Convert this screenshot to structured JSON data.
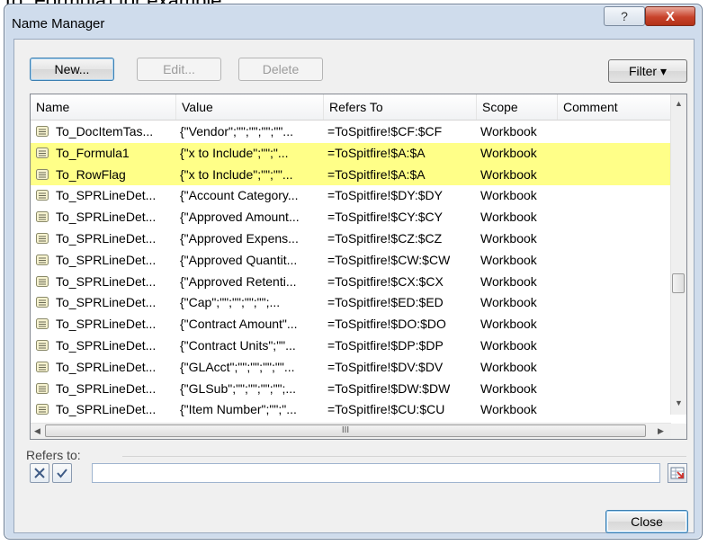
{
  "above_text": "To_Formula) for example.",
  "dialog": {
    "title": "Name Manager",
    "help_label": "?",
    "close_label": "X"
  },
  "toolbar": {
    "new_label": "New...",
    "edit_label": "Edit...",
    "delete_label": "Delete",
    "filter_label": "Filter ▾"
  },
  "columns": [
    "Name",
    "Value",
    "Refers To",
    "Scope",
    "Comment"
  ],
  "rows": [
    {
      "name": "To_DocItemTas...",
      "value": "{\"Vendor\";\"\";\"\";\"\";\"\"...",
      "refers_to": "=ToSpitfire!$CF:$CF",
      "scope": "Workbook",
      "comment": "",
      "highlighted": false
    },
    {
      "name": "To_Formula1",
      "value": "{\"x to Include\";\"\";\"...",
      "refers_to": "=ToSpitfire!$A:$A",
      "scope": "Workbook",
      "comment": "",
      "highlighted": true
    },
    {
      "name": "To_RowFlag",
      "value": "{\"x to Include\";\"\";\"\"...",
      "refers_to": "=ToSpitfire!$A:$A",
      "scope": "Workbook",
      "comment": "",
      "highlighted": true
    },
    {
      "name": "To_SPRLineDet...",
      "value": "{\"Account Category...",
      "refers_to": "=ToSpitfire!$DY:$DY",
      "scope": "Workbook",
      "comment": "",
      "highlighted": false
    },
    {
      "name": "To_SPRLineDet...",
      "value": "{\"Approved Amount...",
      "refers_to": "=ToSpitfire!$CY:$CY",
      "scope": "Workbook",
      "comment": "",
      "highlighted": false
    },
    {
      "name": "To_SPRLineDet...",
      "value": "{\"Approved Expens...",
      "refers_to": "=ToSpitfire!$CZ:$CZ",
      "scope": "Workbook",
      "comment": "",
      "highlighted": false
    },
    {
      "name": "To_SPRLineDet...",
      "value": "{\"Approved Quantit...",
      "refers_to": "=ToSpitfire!$CW:$CW",
      "scope": "Workbook",
      "comment": "",
      "highlighted": false
    },
    {
      "name": "To_SPRLineDet...",
      "value": "{\"Approved Retenti...",
      "refers_to": "=ToSpitfire!$CX:$CX",
      "scope": "Workbook",
      "comment": "",
      "highlighted": false
    },
    {
      "name": "To_SPRLineDet...",
      "value": "{\"Cap\";\"\";\"\";\"\";\"\";...",
      "refers_to": "=ToSpitfire!$ED:$ED",
      "scope": "Workbook",
      "comment": "",
      "highlighted": false
    },
    {
      "name": "To_SPRLineDet...",
      "value": "{\"Contract Amount\"...",
      "refers_to": "=ToSpitfire!$DO:$DO",
      "scope": "Workbook",
      "comment": "",
      "highlighted": false
    },
    {
      "name": "To_SPRLineDet...",
      "value": "{\"Contract Units\";\"\"...",
      "refers_to": "=ToSpitfire!$DP:$DP",
      "scope": "Workbook",
      "comment": "",
      "highlighted": false
    },
    {
      "name": "To_SPRLineDet...",
      "value": "{\"GLAcct\";\"\";\"\";\"\";\"\"...",
      "refers_to": "=ToSpitfire!$DV:$DV",
      "scope": "Workbook",
      "comment": "",
      "highlighted": false
    },
    {
      "name": "To_SPRLineDet...",
      "value": "{\"GLSub\";\"\";\"\";\"\";\"\";...",
      "refers_to": "=ToSpitfire!$DW:$DW",
      "scope": "Workbook",
      "comment": "",
      "highlighted": false
    },
    {
      "name": "To_SPRLineDet...",
      "value": "{\"Item Number\";\"\";\"...",
      "refers_to": "=ToSpitfire!$CU:$CU",
      "scope": "Workbook",
      "comment": "",
      "highlighted": false
    }
  ],
  "hscroll_thumb_glyph": "III",
  "refers_to": {
    "label": "Refers to:",
    "value": ""
  },
  "footer": {
    "close_label": "Close"
  },
  "colors": {
    "highlight": "#ffff88",
    "dialog_frame": "#cfdcec",
    "close_button": "#c8432b"
  },
  "icons": [
    "help-icon",
    "window-close-icon",
    "name-range-icon",
    "cancel-x-icon",
    "confirm-check-icon",
    "collapse-dialog-icon"
  ]
}
